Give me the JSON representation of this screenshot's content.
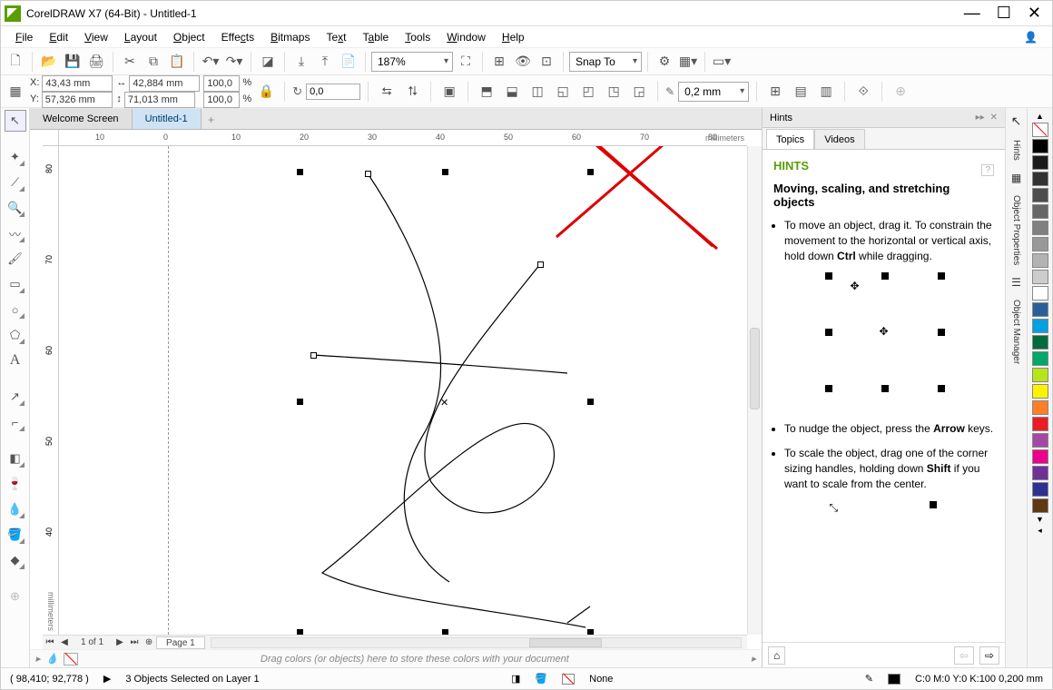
{
  "app": {
    "title": "CorelDRAW X7 (64-Bit) - Untitled-1"
  },
  "menus": [
    "File",
    "Edit",
    "View",
    "Layout",
    "Object",
    "Effects",
    "Bitmaps",
    "Text",
    "Table",
    "Tools",
    "Window",
    "Help"
  ],
  "toolbar1": {
    "zoom": "187%",
    "snapto": "Snap To"
  },
  "propbar": {
    "x": "43,43 mm",
    "y": "57,326 mm",
    "w": "42,884 mm",
    "h": "71,013 mm",
    "sx": "100,0",
    "sy": "100,0",
    "rot": "0,0",
    "outline": "0,2 mm"
  },
  "tabs": {
    "welcome": "Welcome Screen",
    "doc": "Untitled-1"
  },
  "ruler": {
    "unit": "millimeters",
    "hticks": [
      "10",
      "0",
      "10",
      "20",
      "30",
      "40",
      "50",
      "60",
      "70",
      "80"
    ],
    "vticks": [
      "80",
      "70",
      "60",
      "50",
      "40"
    ]
  },
  "pages": {
    "nav": "1 of 1",
    "tab": "Page 1"
  },
  "colorbar": {
    "hint": "Drag colors (or objects) here to store these colors with your document"
  },
  "status": {
    "coords": "( 98,410; 92,778 )",
    "sel": "3 Objects Selected on Layer 1",
    "fill": "None",
    "outline": "C:0 M:0 Y:0 K:100  0,200 mm"
  },
  "hints": {
    "panel": "Hints",
    "tabTopics": "Topics",
    "tabVideos": "Videos",
    "heading": "HINTS",
    "title": "Moving, scaling, and stretching objects",
    "tip1a": "To move an object, drag it. To constrain the movement to the horizontal or vertical axis, hold down ",
    "tip1b": "Ctrl",
    "tip1c": " while dragging.",
    "tip2a": "To nudge the object, press the ",
    "tip2b": "Arrow",
    "tip2c": " keys.",
    "tip3a": "To scale the object, drag one of the corner sizing handles, holding down ",
    "tip3b": "Shift",
    "tip3c": " if you want to scale from the center."
  },
  "docktabs": [
    "Hints",
    "Object Properties",
    "Object Manager"
  ],
  "palette": [
    "#000000",
    "#ffffff",
    "#2a9fd6",
    "#003f7f",
    "#6f4400",
    "#0066cc",
    "#59a5d8",
    "#ff00ff",
    "#800080",
    "#c40000",
    "#ff6600",
    "#ffcc00",
    "#00a651",
    "#009999",
    "#004b23",
    "#7b2d00",
    "#808080",
    "#b0b0b0",
    "#404040"
  ]
}
